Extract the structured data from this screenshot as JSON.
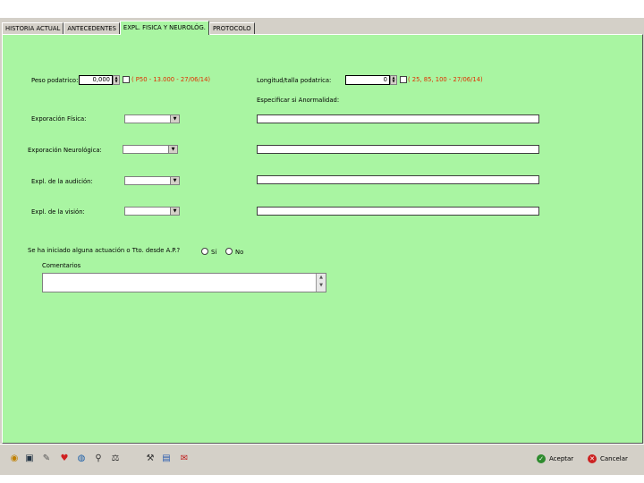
{
  "tabs": [
    "HISTORIA ACTUAL",
    "ANTECEDENTES",
    "EXPL. FISICA Y NEUROLÓG.",
    "PROTOCOLO"
  ],
  "active_tab_index": 2,
  "peso": {
    "label": "Peso podatrico:",
    "value": "0,000",
    "note": "( P50 - 13.000 - 27/06/14)"
  },
  "longitud": {
    "label": "Longitud/talla podatrica:",
    "value": "0",
    "note": "( 25, 85, 100 - 27/06/14)"
  },
  "especificar_label": "Especificar si Anormalidad:",
  "rows": [
    {
      "label": "Exporación Física:"
    },
    {
      "label": "Exporación Neurológica:"
    },
    {
      "label": "Expl. de la audición:"
    },
    {
      "label": "Expl. de la visión:"
    }
  ],
  "question": {
    "label": "Se ha iniciado alguna actuación o Tto. desde A.P.?",
    "yes": "Sí",
    "no": "No"
  },
  "comentarios_label": "Comentarios",
  "toolbar": {
    "icons": [
      "life-ring-icon",
      "monitor-icon",
      "pencil-icon",
      "heart-icon",
      "globe-icon",
      "magnifier-icon",
      "scale-icon",
      "tools-icon",
      "document-icon",
      "envelope-icon"
    ],
    "aceptar": "Aceptar",
    "cancelar": "Cancelar",
    "colors": {
      "panel": "#a9f5a2",
      "aceptar_icon": "#2e8b2e",
      "cancelar_icon": "#cc2222"
    }
  }
}
